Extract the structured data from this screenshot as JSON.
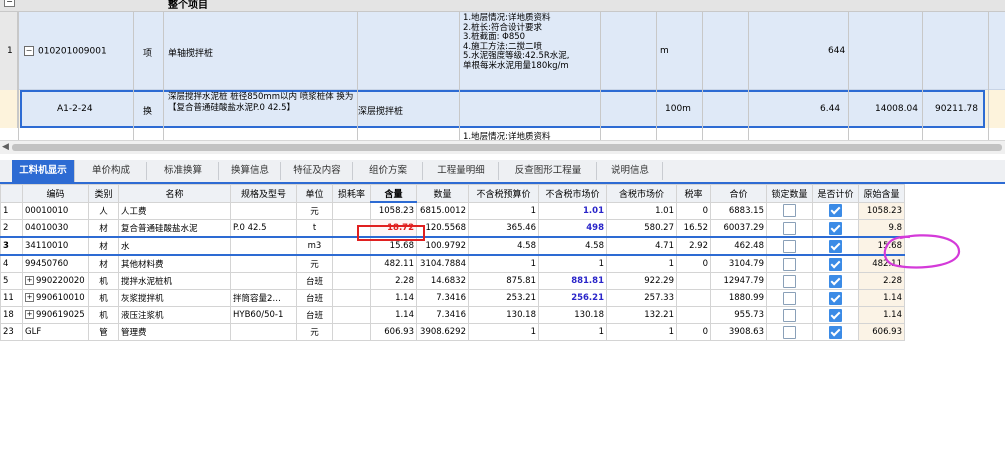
{
  "top_grid": {
    "group_title": "整个项目",
    "group_collapse_glyph": "−",
    "rows": [
      {
        "num": "1",
        "code": "010201009001",
        "type": "项",
        "name": "单轴搅拌桩",
        "feature": [
          "1.地层情况:详地质资料",
          "2.桩长:符合设计要求",
          "3.桩截面: Φ850",
          "4.施工方法:二搅二喷",
          "5.水泥强度等级:42.5R水泥,",
          "单根每米水泥用量180kg/m"
        ],
        "unit": "m",
        "qty": "644"
      },
      {
        "code": "A1-2-24",
        "type": "换",
        "name": "深层搅拌水泥桩 桩径850mm以内 喷浆桩体 换为【复合普通硅酸盐水泥P.0 42.5】",
        "specialty": "深层搅拌桩",
        "unit": "100m",
        "qty": "6.44",
        "price": "14008.04",
        "total": "90211.78"
      }
    ],
    "next_feature_peek": "1.地层情况:详地质资料"
  },
  "tabs": [
    "工料机显示",
    "单价构成",
    "标准换算",
    "换算信息",
    "特征及内容",
    "组价方案",
    "工程量明细",
    "反查图形工程量",
    "说明信息"
  ],
  "columns": [
    "编码",
    "类别",
    "名称",
    "规格及型号",
    "单位",
    "损耗率",
    "含量",
    "数量",
    "不含税预算价",
    "不含税市场价",
    "含税市场价",
    "税率",
    "合价",
    "锁定数量",
    "是否计价",
    "原始含量"
  ],
  "rows": [
    {
      "rn": "1",
      "code": "00010010",
      "cat": "人",
      "name": "人工费",
      "spec": "",
      "unit": "元",
      "loss": "",
      "content": "1058.23",
      "qty": "6815.0012",
      "pre": "1",
      "mkt": "1.01",
      "mkt_blue": true,
      "mkt_tax": "1.01",
      "tax": "0",
      "total": "6883.15",
      "locked": false,
      "priced": true,
      "orig": "1058.23",
      "expandable": false
    },
    {
      "rn": "2",
      "code": "04010030",
      "cat": "材",
      "name": "复合普通硅酸盐水泥",
      "spec": "P.0 42.5",
      "unit": "t",
      "loss": "",
      "content": "18.72",
      "qty": "120.5568",
      "pre": "365.46",
      "mkt": "498",
      "mkt_blue": true,
      "mkt_tax": "580.27",
      "tax": "16.52",
      "total": "60037.29",
      "locked": false,
      "priced": true,
      "orig": "9.8",
      "expandable": false
    },
    {
      "rn": "3",
      "code": "34110010",
      "cat": "材",
      "name": "水",
      "spec": "",
      "unit": "m3",
      "loss": "",
      "content": "15.68",
      "qty": "100.9792",
      "pre": "4.58",
      "mkt": "4.58",
      "mkt_blue": false,
      "mkt_tax": "4.71",
      "tax": "2.92",
      "total": "462.48",
      "locked": false,
      "priced": true,
      "orig": "15.68",
      "expandable": false
    },
    {
      "rn": "4",
      "code": "99450760",
      "cat": "材",
      "name": "其他材料费",
      "spec": "",
      "unit": "元",
      "loss": "",
      "content": "482.11",
      "qty": "3104.7884",
      "pre": "1",
      "mkt": "1",
      "mkt_blue": false,
      "mkt_tax": "1",
      "tax": "0",
      "total": "3104.79",
      "locked": false,
      "priced": true,
      "orig": "482.11",
      "expandable": false
    },
    {
      "rn": "5",
      "code": "990220020",
      "cat": "机",
      "name": "搅拌水泥桩机",
      "spec": "",
      "unit": "台班",
      "loss": "",
      "content": "2.28",
      "qty": "14.6832",
      "pre": "875.81",
      "mkt": "881.81",
      "mkt_blue": true,
      "mkt_tax": "922.29",
      "tax": "",
      "total": "12947.79",
      "locked": false,
      "priced": true,
      "orig": "2.28",
      "expandable": true
    },
    {
      "rn": "11",
      "code": "990610010",
      "cat": "机",
      "name": "灰浆搅拌机",
      "spec": "拌筒容量2…",
      "unit": "台班",
      "loss": "",
      "content": "1.14",
      "qty": "7.3416",
      "pre": "253.21",
      "mkt": "256.21",
      "mkt_blue": true,
      "mkt_tax": "257.33",
      "tax": "",
      "total": "1880.99",
      "locked": false,
      "priced": true,
      "orig": "1.14",
      "expandable": true
    },
    {
      "rn": "18",
      "code": "990619025",
      "cat": "机",
      "name": "液压注浆机",
      "spec": "HYB60/50-1",
      "unit": "台班",
      "loss": "",
      "content": "1.14",
      "qty": "7.3416",
      "pre": "130.18",
      "mkt": "130.18",
      "mkt_blue": false,
      "mkt_tax": "132.21",
      "tax": "",
      "total": "955.73",
      "locked": false,
      "priced": true,
      "orig": "1.14",
      "expandable": true
    },
    {
      "rn": "23",
      "code": "GLF",
      "cat": "管",
      "name": "管理费",
      "spec": "",
      "unit": "元",
      "loss": "",
      "content": "606.93",
      "qty": "3908.6292",
      "pre": "1",
      "mkt": "1",
      "mkt_blue": false,
      "mkt_tax": "1",
      "tax": "0",
      "total": "3908.63",
      "locked": false,
      "priced": true,
      "orig": "606.93",
      "expandable": false
    }
  ],
  "plus_glyph": "+",
  "colors": {
    "accent": "#2d6bd3",
    "highlight_red": "#e02020",
    "annotation_magenta": "#d43ad9",
    "selected_row_bg": "#fdf3dc",
    "row1_bg": "#dfe9f7"
  }
}
